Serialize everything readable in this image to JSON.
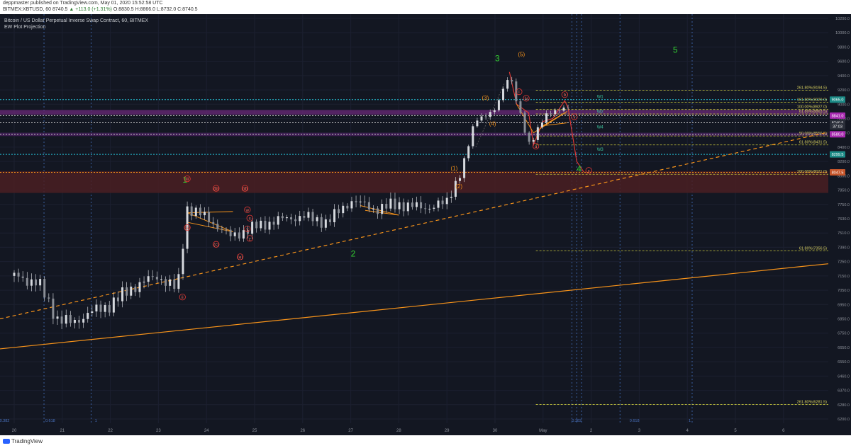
{
  "header": {
    "publish_line": "deppmaster published on TradingView.com, May 01, 2020 15:52:58 UTC",
    "symbol_line": "BITMEX:XBTUSD, 60 8740.5",
    "change": "▲ +113.0 (+1.31%)",
    "ohlc": "O:8830.5 H:8866.0 L:8732.0 C:8740.5"
  },
  "legend": {
    "title": "Bitcoin / US Dollar Perpetual Inverse Swap Contract, 60, BITMEX",
    "indicator": "EW Plot Projection"
  },
  "footer": {
    "brand": "TradingView"
  },
  "colors": {
    "background": "#131722",
    "up": "#c9ccd1",
    "orange": "#f7931a",
    "green": "#33cc33",
    "cyan": "#26c6da",
    "magenta": "#b23ecf",
    "red": "#e53935",
    "yellow": "#c8c83c"
  },
  "chart_data": {
    "type": "candlestick",
    "title": "Bitcoin / US Dollar Perpetual Inverse Swap Contract, 60, BITMEX",
    "x_ticks": [
      "20",
      "21",
      "22",
      "23",
      "24",
      "25",
      "26",
      "27",
      "28",
      "29",
      "30",
      "May",
      "2",
      "3",
      "4",
      "5",
      "6"
    ],
    "y_ticks": [
      "10200.0",
      "10000.0",
      "9800.0",
      "9600.0",
      "9400.0",
      "9200.0",
      "9000.0",
      "8800.0",
      "8600.0",
      "8400.0",
      "8200.0",
      "8000.0",
      "7850.0",
      "7750.0",
      "7630.0",
      "7510.0",
      "7390.0",
      "7250.0",
      "7150.0",
      "7050.0",
      "6950.0",
      "6850.0",
      "6750.0",
      "6650.0",
      "6550.0",
      "6460.0",
      "6370.0",
      "6280.0",
      "6200.0"
    ],
    "ylim": [
      6200,
      10200
    ],
    "price_series": {
      "name": "XBTUSD",
      "points": [
        [
          "20",
          7150
        ],
        [
          "20.5",
          7100
        ],
        [
          "21",
          6800
        ],
        [
          "21.5",
          6850
        ],
        [
          "22",
          6950
        ],
        [
          "22.5",
          7080
        ],
        [
          "23",
          7150
        ],
        [
          "23.4",
          7050
        ],
        [
          "23.6",
          7700
        ],
        [
          "24",
          7650
        ],
        [
          "24.5",
          7480
        ],
        [
          "25",
          7560
        ],
        [
          "25.5",
          7620
        ],
        [
          "26",
          7650
        ],
        [
          "26.5",
          7600
        ],
        [
          "27",
          7780
        ],
        [
          "27.5",
          7710
        ],
        [
          "28",
          7750
        ],
        [
          "28.5",
          7720
        ],
        [
          "29",
          7760
        ],
        [
          "29.3",
          8050
        ],
        [
          "29.6",
          8800
        ],
        [
          "30",
          8900
        ],
        [
          "30.3",
          9450
        ],
        [
          "30.5",
          8900
        ],
        [
          "30.7",
          8400
        ],
        [
          "May",
          8800
        ],
        [
          "May.5",
          9000
        ],
        [
          "May.6",
          8740.5
        ]
      ]
    },
    "current_price": "8740.5",
    "price_tags": [
      "9065.0",
      "8841.0",
      "8740.5",
      "37:03",
      "8580.0",
      "8299.5",
      "8047.5"
    ],
    "fib_labels": [
      "261.80%(9194.5)",
      "161.80%(9029.0)",
      "100.00%(8927.0)",
      "61.80%(8863.5)",
      "50.00%(8556.5)",
      "61.80%(8431.5)",
      "100.00%(8021.0)",
      "61.80%(7356.5)",
      "261.80%(6281.5)"
    ],
    "w_labels": [
      "W1",
      "W2",
      "W4",
      "W3"
    ],
    "major_waves": [
      "1",
      "2",
      "3",
      "4",
      "5"
    ],
    "intermediate_waves": [
      "(1)",
      "(2)",
      "(3)",
      "(4)",
      "(5)"
    ],
    "sub_waves": [
      "(a)",
      "(b)",
      "(c)",
      "(d)",
      "(e)",
      "i",
      "ii",
      "iii",
      "iv",
      "v",
      "a",
      "b",
      "c",
      "w",
      "x",
      "y",
      "z"
    ],
    "time_fib_labels": [
      "0.382",
      "0.618",
      "1",
      "0.382",
      "0.618",
      "1"
    ]
  }
}
